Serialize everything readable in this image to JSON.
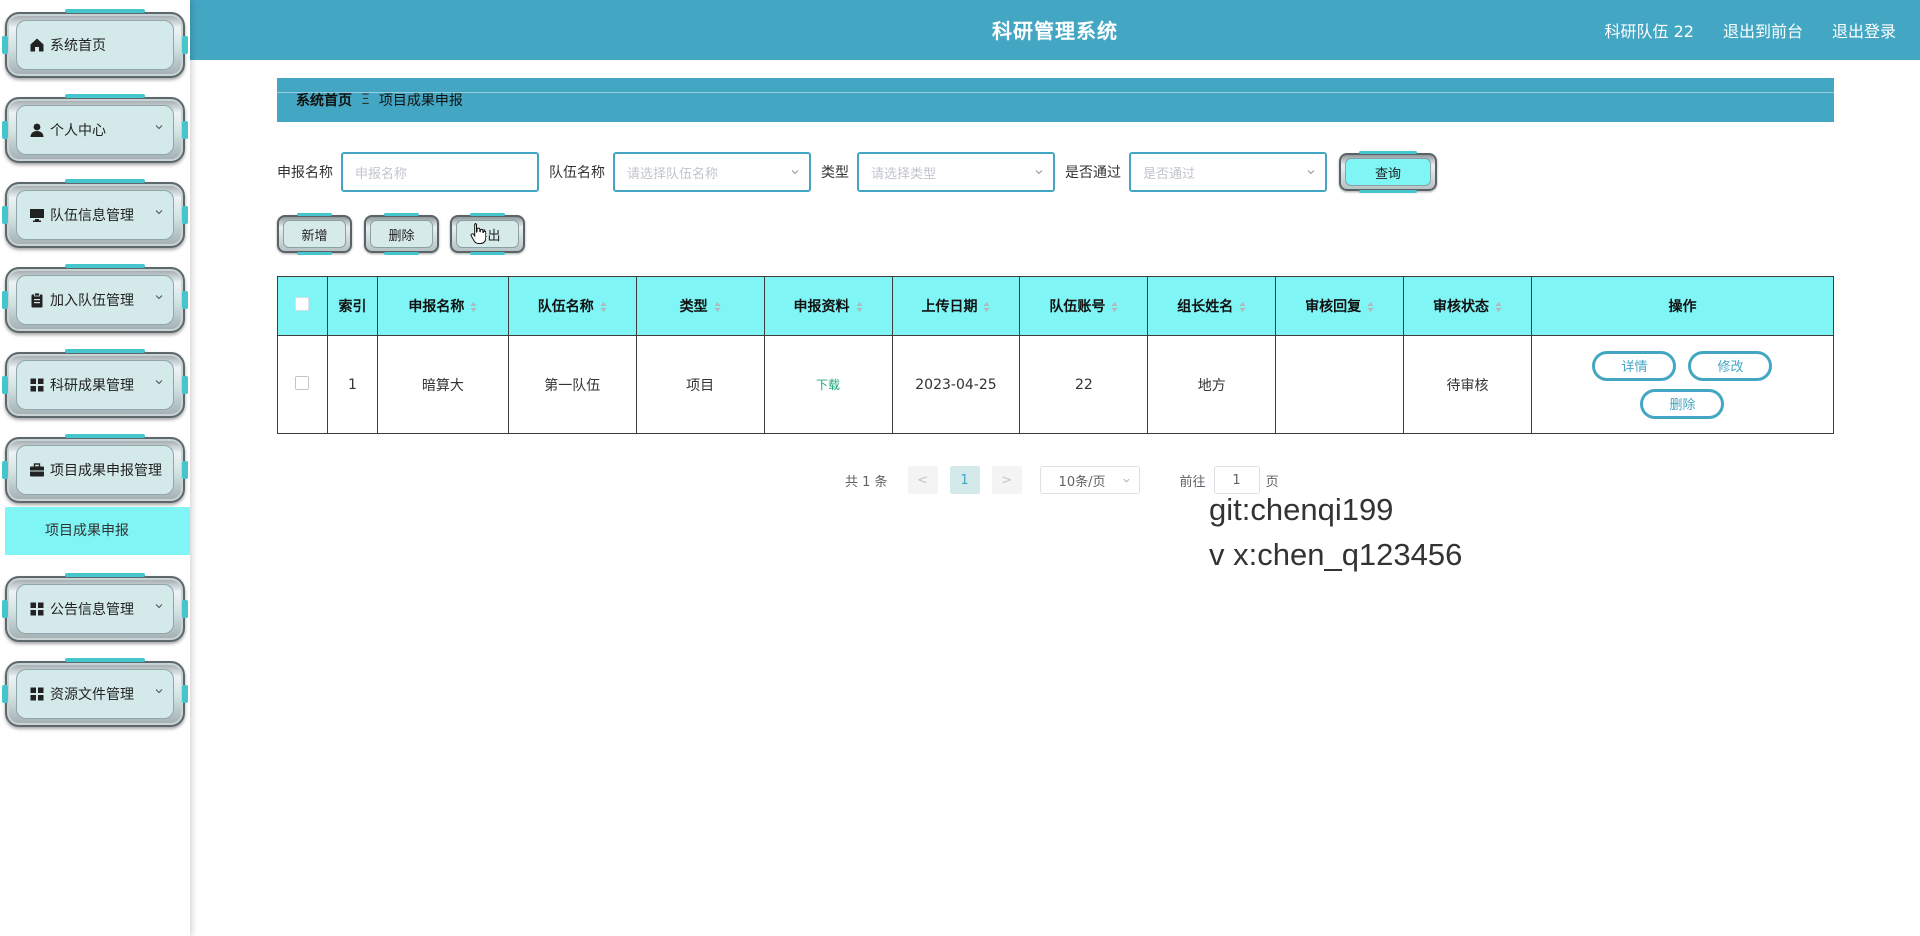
{
  "header": {
    "title": "科研管理系统",
    "user": "科研队伍 22",
    "frontend_label": "退出到前台",
    "logout_label": "退出登录"
  },
  "sidebar": {
    "items": [
      {
        "label": "系统首页",
        "icon": "home-icon"
      },
      {
        "label": "个人中心",
        "icon": "user-icon"
      },
      {
        "label": "队伍信息管理",
        "icon": "monitor-icon"
      },
      {
        "label": "加入队伍管理",
        "icon": "clipboard-icon"
      },
      {
        "label": "科研成果管理",
        "icon": "grid-icon"
      },
      {
        "label": "项目成果申报管理",
        "icon": "briefcase-icon"
      },
      {
        "label": "公告信息管理",
        "icon": "grid-icon"
      },
      {
        "label": "资源文件管理",
        "icon": "grid-icon"
      }
    ],
    "active_subitem": "项目成果申报"
  },
  "breadcrumb": {
    "home": "系统首页",
    "separator": "Ξ",
    "current": "项目成果申报"
  },
  "search": {
    "name_label": "申报名称",
    "name_placeholder": "申报名称",
    "team_label": "队伍名称",
    "team_placeholder": "请选择队伍名称",
    "type_label": "类型",
    "type_placeholder": "请选择类型",
    "pass_label": "是否通过",
    "pass_placeholder": "是否通过",
    "query_label": "查询"
  },
  "toolbar": {
    "add_label": "新增",
    "delete_label": "删除",
    "export_label": "导出"
  },
  "table": {
    "headers": [
      "索引",
      "申报名称",
      "队伍名称",
      "类型",
      "申报资料",
      "上传日期",
      "队伍账号",
      "组长姓名",
      "审核回复",
      "审核状态",
      "操作"
    ],
    "rows": [
      {
        "index": "1",
        "name": "暗算大",
        "team": "第一队伍",
        "type": "项目",
        "file": "下载",
        "date": "2023-04-25",
        "account": "22",
        "leader": "地方",
        "reply": "",
        "status": "待审核",
        "actions": {
          "detail": "详情",
          "edit": "修改",
          "delete": "删除"
        }
      }
    ]
  },
  "pagination": {
    "total": "共 1 条",
    "prev": "<",
    "page": "1",
    "next": ">",
    "page_size": "10条/页",
    "goto_label": "前往",
    "goto_value": "1",
    "page_unit": "页"
  },
  "watermark": {
    "line1": "git:chenqi199",
    "line2": "v x:chen_q123456"
  },
  "colors": {
    "primary": "#43a7c4",
    "cyan": "#7ff5f5",
    "link_green": "#1fa37a"
  }
}
